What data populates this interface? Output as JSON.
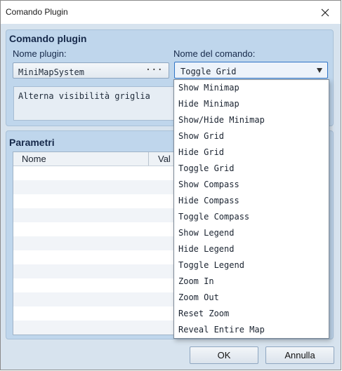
{
  "window": {
    "title": "Comando Plugin"
  },
  "plugin_group": {
    "title": "Comando plugin",
    "plugin_label": "Nome plugin:",
    "plugin_value": "MiniMapSystem",
    "plugin_browse": "···",
    "command_label": "Nome del comando:",
    "command_value": "Toggle Grid",
    "description": "Alterna visibilità griglia"
  },
  "params_group": {
    "title": "Parametri",
    "columns": [
      "Nome",
      "Valore"
    ],
    "visible_value_header": "Val"
  },
  "dropdown": {
    "options": [
      "Show Minimap",
      "Hide Minimap",
      "Show/Hide Minimap",
      "Show Grid",
      "Hide Grid",
      "Toggle Grid",
      "Show Compass",
      "Hide Compass",
      "Toggle Compass",
      "Show Legend",
      "Hide Legend",
      "Toggle Legend",
      "Zoom In",
      "Zoom Out",
      "Reset Zoom",
      "Reveal Entire Map"
    ]
  },
  "buttons": {
    "ok": "OK",
    "cancel": "Annulla"
  },
  "colors": {
    "accent": "#2f74c6",
    "panel": "#bfd6ec",
    "background": "#d7e3ee"
  }
}
